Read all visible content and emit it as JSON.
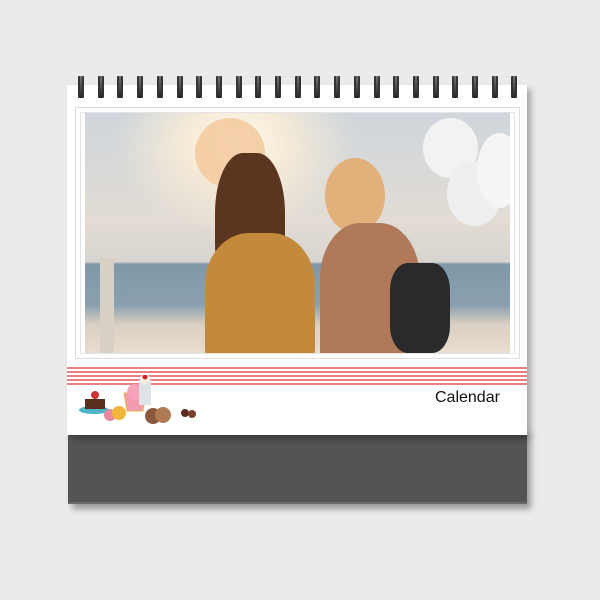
{
  "calendar": {
    "title": "Calendar",
    "ring_count": 23,
    "colors": {
      "stripe": "#e97f84",
      "base": "#545454",
      "background": "#ebebeb"
    },
    "photo_description_icon": "photo-two-women-on-bicycle",
    "decoration_icon": "desserts-illustration"
  }
}
